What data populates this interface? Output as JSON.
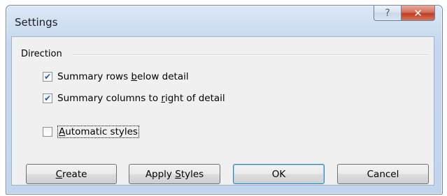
{
  "window": {
    "title": "Settings"
  },
  "titlebar": {
    "help_glyph": "?",
    "close_glyph": "✕"
  },
  "group": {
    "label": "Direction"
  },
  "checkboxes": [
    {
      "pre": "Summary rows ",
      "u": "b",
      "post": "elow detail",
      "checked": true
    },
    {
      "pre": "Summary columns to ",
      "u": "r",
      "post": "ight of detail",
      "checked": true
    },
    {
      "pre": "",
      "u": "A",
      "post": "utomatic styles",
      "checked": false
    }
  ],
  "buttons": {
    "create": {
      "pre": "",
      "u": "C",
      "post": "reate"
    },
    "apply": {
      "pre": "Apply ",
      "u": "S",
      "post": "tyles"
    },
    "ok": {
      "label": "OK"
    },
    "cancel": {
      "label": "Cancel"
    }
  },
  "check_glyph": "✔",
  "icons": {
    "help": "help-icon",
    "close": "close-icon",
    "check": "checkmark-icon"
  },
  "colors": {
    "title_gradient_top": "#dbe8f6",
    "close_red": "#c4432a",
    "default_button_border": "#3c7fb1"
  }
}
